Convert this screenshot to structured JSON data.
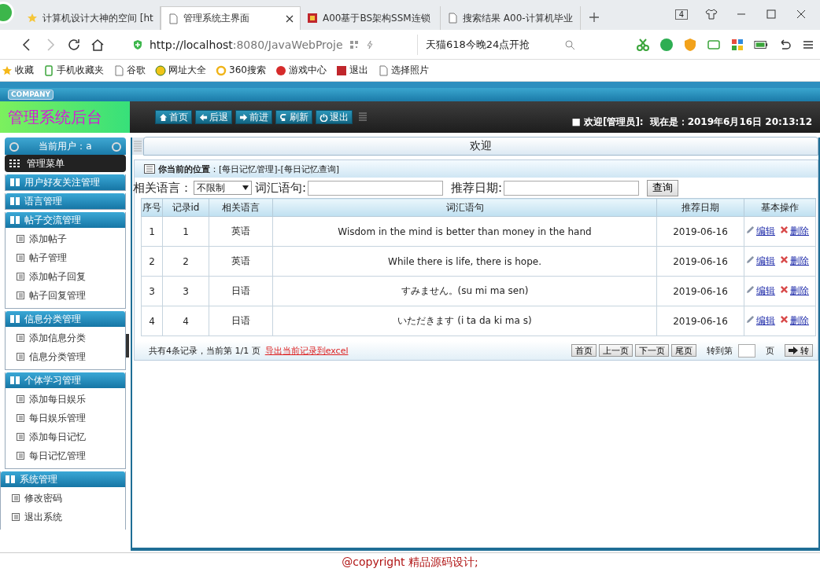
{
  "browser": {
    "tabs": [
      {
        "title": "计算机设计大神的空间 [ht",
        "selected": false
      },
      {
        "title": "管理系统主界面",
        "selected": true
      },
      {
        "title": "A00基于BS架构SSM连锁",
        "selected": false
      },
      {
        "title": "搜索结果 A00-计算机毕业",
        "selected": false
      }
    ],
    "tab_count": "4",
    "url_host": "http://localhost",
    "url_rest": ":8080/JavaWebProje",
    "search": "天猫618今晚24点开抢",
    "bookmarks": [
      "收藏",
      "手机收藏夹",
      "谷歌",
      "网址大全",
      "360搜索",
      "游戏中心",
      "退出",
      "选择照片"
    ]
  },
  "header": {
    "company": "COMPANY",
    "title": "管理系统后台",
    "nav": [
      "首页",
      "后退",
      "前进",
      "刷新",
      "退出"
    ],
    "welcome": "■ 欢迎[管理员]:",
    "time": "现在是：2019年6月16日 20:13:12"
  },
  "sidebar": {
    "user": "当前用户：a",
    "menu_title": "管理菜单",
    "groups": [
      {
        "title": "用户好友关注管理"
      },
      {
        "title": "语言管理"
      },
      {
        "title": "帖子交流管理",
        "items": [
          "添加帖子",
          "帖子管理",
          "添加帖子回复",
          "帖子回复管理"
        ]
      },
      {
        "title": "信息分类管理",
        "items": [
          "添加信息分类",
          "信息分类管理"
        ]
      },
      {
        "title": "个体学习管理",
        "items": [
          "添加每日娱乐",
          "每日娱乐管理",
          "添加每日记忆",
          "每日记忆管理"
        ]
      },
      {
        "title": "系统管理",
        "items": [
          "修改密码",
          "退出系统"
        ]
      }
    ]
  },
  "content": {
    "tab_title": "欢迎",
    "breadcrumb": "**你当前的位置**：[每日记忆管理]-[每日记忆查询]",
    "filters": {
      "language_label": "相关语言：",
      "language_value": "不限制",
      "phrase_label": "词汇语句:",
      "date_label": "推荐日期:",
      "search_button": "查询"
    },
    "table": {
      "columns": [
        "序号",
        "记录id",
        "相关语言",
        "词汇语句",
        "推荐日期",
        "基本操作"
      ],
      "rows": [
        {
          "cells": [
            "1",
            "1",
            "英语",
            "Wisdom in the mind is better than money in the hand",
            "2019-06-16"
          ],
          "actions": [
            "编辑",
            "删除"
          ]
        },
        {
          "cells": [
            "2",
            "2",
            "英语",
            "While there is life, there is hope.",
            "2019-06-16"
          ],
          "actions": [
            "编辑",
            "删除"
          ]
        },
        {
          "cells": [
            "3",
            "3",
            "日语",
            "すみません。(su mi ma sen)",
            "2019-06-16"
          ],
          "actions": [
            "编辑",
            "删除"
          ]
        },
        {
          "cells": [
            "4",
            "4",
            "日语",
            "いただきます (i ta da ki ma s)",
            "2019-06-16"
          ],
          "actions": [
            "编辑",
            "删除"
          ]
        }
      ]
    },
    "pager": {
      "summary": "共有4条记录，当前第 1/1 页",
      "export_link": "导出当前记录到excel",
      "buttons": [
        "首页",
        "上一页",
        "下一页",
        "尾页"
      ],
      "goto_label": "转到第",
      "page_unit": "页",
      "go_button": "转"
    }
  },
  "footer": "@copyright 精品源码设计;"
}
